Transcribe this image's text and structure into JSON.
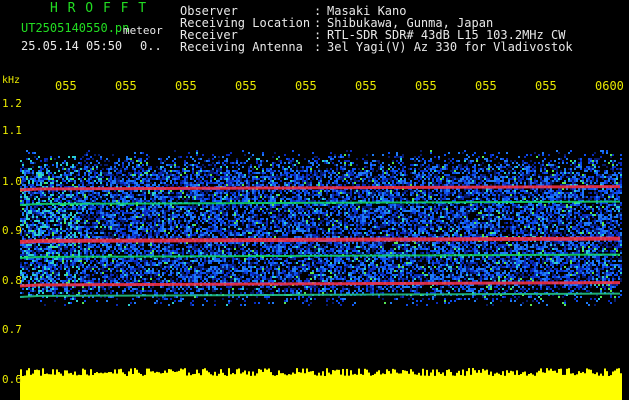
{
  "header": {
    "program": "H R O F F T",
    "filename": "UT2505140550.pn",
    "filename_suffix": "meteor",
    "datetime": "25.05.14 05:50",
    "datetime_suffix": "0..",
    "fields": [
      {
        "label": "Observer",
        "sep": ":",
        "value": "Masaki Kano"
      },
      {
        "label": "Receiving Location",
        "sep": ":",
        "value": "Shibukawa, Gunma, Japan"
      },
      {
        "label": "Receiver",
        "sep": ":",
        "value": "RTL-SDR SDR# 43dB L15 103.2MHz CW"
      },
      {
        "label": "Receiving Antenna",
        "sep": ":",
        "value": "3el Yagi(V) Az 330 for Vladivostok"
      }
    ]
  },
  "axes": {
    "y_unit": "kHz",
    "y_ticks": [
      "1.2",
      "1.1",
      "1.0",
      "0.9",
      "0.8",
      "0.7",
      "0.6"
    ],
    "x_ticks": [
      "055",
      "055",
      "055",
      "055",
      "055",
      "055",
      "055",
      "055",
      "055",
      "0600"
    ]
  },
  "colors": {
    "header_green": "#22dd22",
    "header_white": "#e8e8e8",
    "tick_yellow": "#e8e800",
    "signal_red": "#ff3030",
    "echo_band": "#ffff00"
  }
}
